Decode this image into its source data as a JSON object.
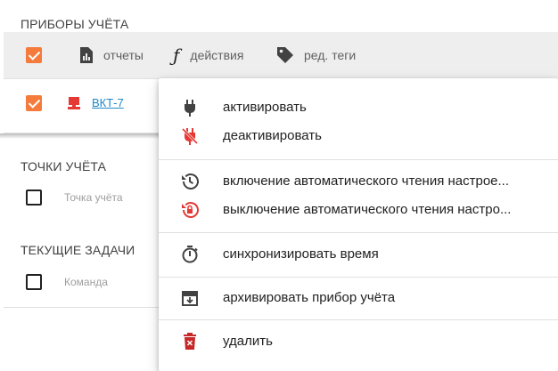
{
  "devices": {
    "title": "ПРИБОРЫ УЧЁТА",
    "toolbar": {
      "reports_label": "отчеты",
      "actions_label": "действия",
      "tags_label": "ред. теги"
    },
    "rows": [
      {
        "name": "ВКТ-7",
        "checked": true
      }
    ]
  },
  "points": {
    "title": "ТОЧКИ УЧЁТА",
    "column_label": "Точка учёта"
  },
  "tasks": {
    "title": "ТЕКУЩИЕ ЗАДАЧИ",
    "column_label": "Команда"
  },
  "context_menu": {
    "items": [
      {
        "label": "активировать",
        "icon": "plug-icon"
      },
      {
        "label": "деактивировать",
        "icon": "plug-off-icon"
      },
      {
        "label": "включение автоматического чтения настрое...",
        "icon": "history-icon"
      },
      {
        "label": "выключение автоматического чтения настро...",
        "icon": "lock-reset-icon"
      },
      {
        "label": "синхронизировать время",
        "icon": "timer-icon"
      },
      {
        "label": "архивировать прибор учёта",
        "icon": "archive-icon"
      },
      {
        "label": "удалить",
        "icon": "trash-icon"
      }
    ]
  },
  "colors": {
    "accent": "#f47b3c",
    "link": "#1e88c9",
    "danger": "#e53935",
    "toolbar_bg": "#eeeeee"
  }
}
